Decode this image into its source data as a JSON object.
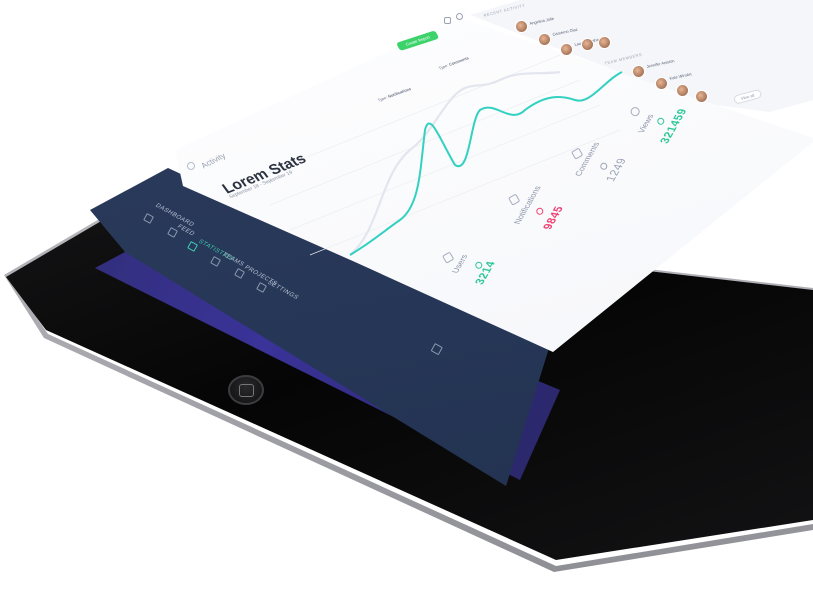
{
  "sidebar": {
    "items": [
      {
        "label": "DASHBOARD",
        "active": false,
        "icon": "dashboard-icon"
      },
      {
        "label": "FEED",
        "active": false,
        "icon": "feed-icon"
      },
      {
        "label": "STATISTICS",
        "active": true,
        "icon": "statistics-icon"
      },
      {
        "label": "TEAMS",
        "active": false,
        "icon": "teams-icon"
      },
      {
        "label": "PROJECTS",
        "active": false,
        "icon": "projects-icon"
      },
      {
        "label": "SETTINGS",
        "active": false,
        "icon": "settings-icon"
      }
    ]
  },
  "header": {
    "section": "Activity",
    "button_label": "Create Report"
  },
  "main": {
    "title": "Lorem Stats",
    "subtitle": "September 18 - September 19",
    "filters": [
      {
        "prefix": "Type:",
        "value": "Notifications"
      },
      {
        "prefix": "Type:",
        "value": "Comments"
      }
    ]
  },
  "stats": [
    {
      "label": "Users",
      "value": "3214",
      "color": "#2fc79a",
      "icon": "users-icon"
    },
    {
      "label": "Notifications",
      "value": "9845",
      "color": "#ef4273",
      "icon": "notifications-icon"
    },
    {
      "label": "Comments",
      "value": "1249",
      "color": "#9aa3b5",
      "icon": "comments-icon"
    },
    {
      "label": "Views",
      "value": "321459",
      "color": "#2fc79a",
      "icon": "views-icon"
    }
  ],
  "right_panel": {
    "recent_header": "RECENT ACTIVITY",
    "team_header": "TEAM MEMBERS",
    "people": [
      {
        "name": "Angelina Jolie",
        "sub": "Manager"
      },
      {
        "name": "Cameron Diaz",
        "sub": "Designer"
      },
      {
        "name": "Lauren Graham",
        "sub": "Developer"
      },
      {
        "name": "Jennifer Aniston",
        "sub": "Designer"
      },
      {
        "name": "Kate Winslet",
        "sub": "Manager"
      }
    ],
    "view_all": "View all"
  },
  "colors": {
    "accent": "#3fd0b3",
    "sidebar_bg": "#263656",
    "button_green": "#3cd36b",
    "negative": "#ef4273"
  }
}
